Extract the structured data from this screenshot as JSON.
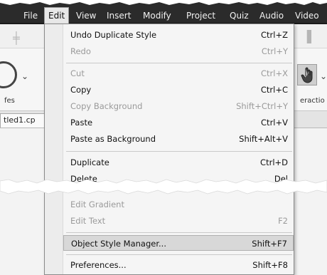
{
  "menubar": {
    "items": [
      "File",
      "Edit",
      "View",
      "Insert",
      "Modify",
      "Project",
      "Quiz",
      "Audio",
      "Video"
    ],
    "active": "Edit"
  },
  "background": {
    "left_label": "fes",
    "right_label": "eractio",
    "doc_tab": "tled1.cp"
  },
  "edit_menu": {
    "undo": {
      "label": "Undo Duplicate Style",
      "shortcut": "Ctrl+Z"
    },
    "redo": {
      "label": "Redo",
      "shortcut": "Ctrl+Y"
    },
    "cut": {
      "label": "Cut",
      "shortcut": "Ctrl+X"
    },
    "copy": {
      "label": "Copy",
      "shortcut": "Ctrl+C"
    },
    "copy_background": {
      "label": "Copy Background",
      "shortcut": "Shift+Ctrl+Y"
    },
    "paste": {
      "label": "Paste",
      "shortcut": "Ctrl+V"
    },
    "paste_background": {
      "label": "Paste as Background",
      "shortcut": "Shift+Alt+V"
    },
    "duplicate": {
      "label": "Duplicate",
      "shortcut": "Ctrl+D"
    },
    "delete": {
      "label": "Delete",
      "shortcut": "Del"
    },
    "edit_gradient": {
      "label": "Edit Gradient",
      "shortcut": ""
    },
    "edit_text": {
      "label": "Edit Text",
      "shortcut": "F2"
    },
    "object_style_manager": {
      "label": "Object Style Manager...",
      "shortcut": "Shift+F7"
    },
    "preferences": {
      "label": "Preferences...",
      "shortcut": "Shift+F8"
    }
  },
  "colors": {
    "menubar": "#2b2b2b",
    "menu_bg": "#f5f5f5",
    "highlight": "#d8d8d8",
    "disabled_text": "#9a9a9a"
  }
}
